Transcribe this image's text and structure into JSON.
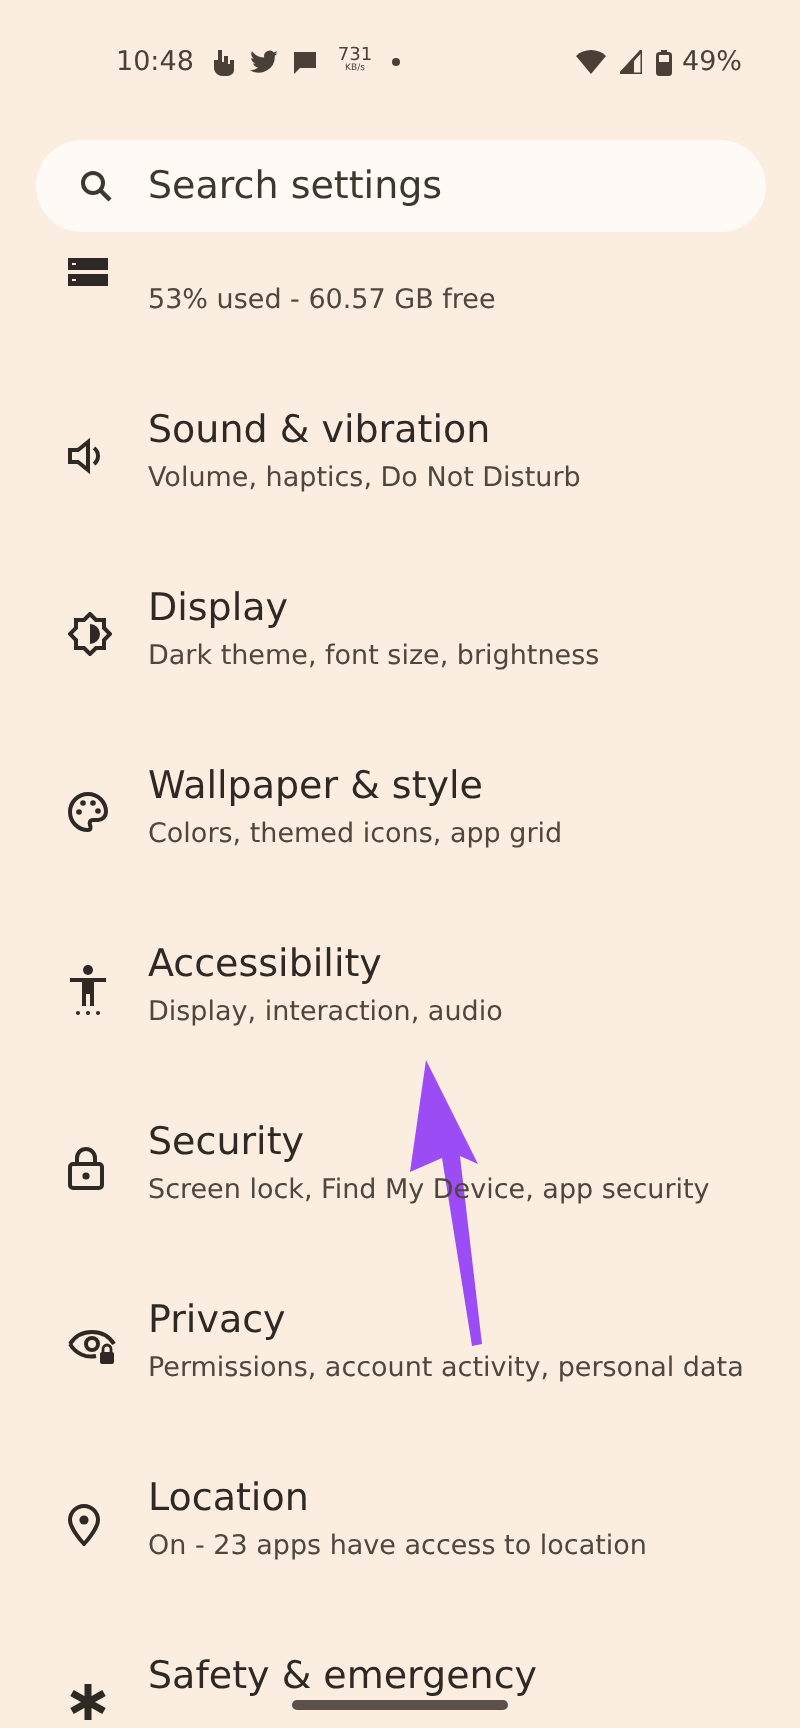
{
  "status_bar": {
    "time": "10:48",
    "speed": "731",
    "speed_unit": "KB/s",
    "battery": "49%"
  },
  "search": {
    "placeholder": "Search settings"
  },
  "settings": [
    {
      "subtitle": "53% used - 60.57 GB free"
    },
    {
      "title": "Sound & vibration",
      "subtitle": "Volume, haptics, Do Not Disturb"
    },
    {
      "title": "Display",
      "subtitle": "Dark theme, font size, brightness"
    },
    {
      "title": "Wallpaper & style",
      "subtitle": "Colors, themed icons, app grid"
    },
    {
      "title": "Accessibility",
      "subtitle": "Display, interaction, audio"
    },
    {
      "title": "Security",
      "subtitle": "Screen lock, Find My Device, app security"
    },
    {
      "title": "Privacy",
      "subtitle": "Permissions, account activity, personal data"
    },
    {
      "title": "Location",
      "subtitle": "On - 23 apps have access to location"
    },
    {
      "title": "Safety & emergency"
    }
  ]
}
